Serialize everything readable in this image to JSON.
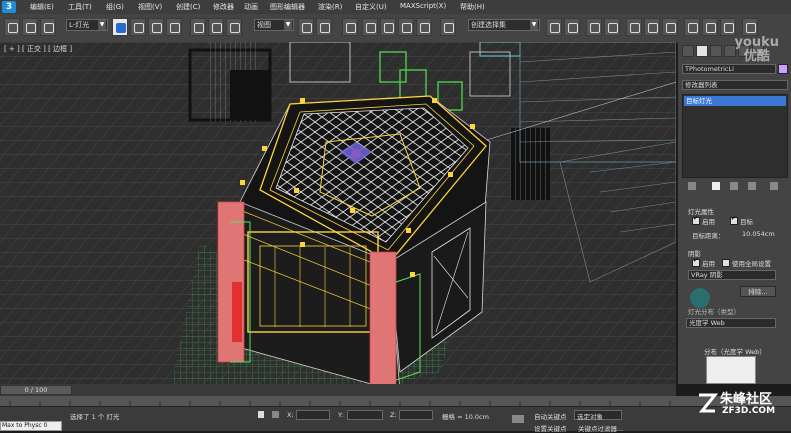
{
  "app": {
    "logo_text": "3"
  },
  "menu": [
    "编辑(E)",
    "工具(T)",
    "组(G)",
    "视图(V)",
    "创建(C)",
    "修改器",
    "动画",
    "图形编辑器",
    "渲染(R)",
    "自定义(U)",
    "MAXScript(X)",
    "帮助(H)"
  ],
  "toolbar": {
    "selection_filter": "L-灯光",
    "ref_coord": "视图",
    "named_selection": "创建选择集"
  },
  "viewport": {
    "label": "[ + ] [ 正交 ] [ 边框 ]"
  },
  "command_panel": {
    "object_name": "TPhotometricLi",
    "modifier_list": "修改器列表",
    "stack_item": "目标灯光",
    "rollout_light_props": "灯光属性",
    "enabled_label": "启用",
    "target_label": "目标",
    "target_distance_label": "目标距离：",
    "target_distance_value": "10.054cm",
    "shadows_title": "阴影",
    "shadows_enabled": "启用",
    "use_global": "使用全局设置",
    "shadow_type": "VRay 阴影",
    "exclude_button": "排除...",
    "distribution_title": "灯光分布（类型）",
    "distribution_type": "光度学 Web",
    "distribution_rollout": "分布（光度学 Web）"
  },
  "timeline": {
    "frame_label": "0 / 100"
  },
  "status": {
    "selected_text": "选择了 1 个 灯光",
    "x_label": "X:",
    "y_label": "Y:",
    "z_label": "Z:",
    "grid_label": "栅格 = 10.0cm",
    "autokey": "自动关键点",
    "selected_set": "选定对象",
    "set_key": "设置关键点",
    "key_filters": "关键点过滤器...",
    "maxscript_hint": "Max to Physc 0"
  },
  "watermarks": {
    "youku": "youku",
    "youku_cn": "优酷",
    "zf_cn": "朱峰社区",
    "zf_url": "ZF3D.COM"
  }
}
